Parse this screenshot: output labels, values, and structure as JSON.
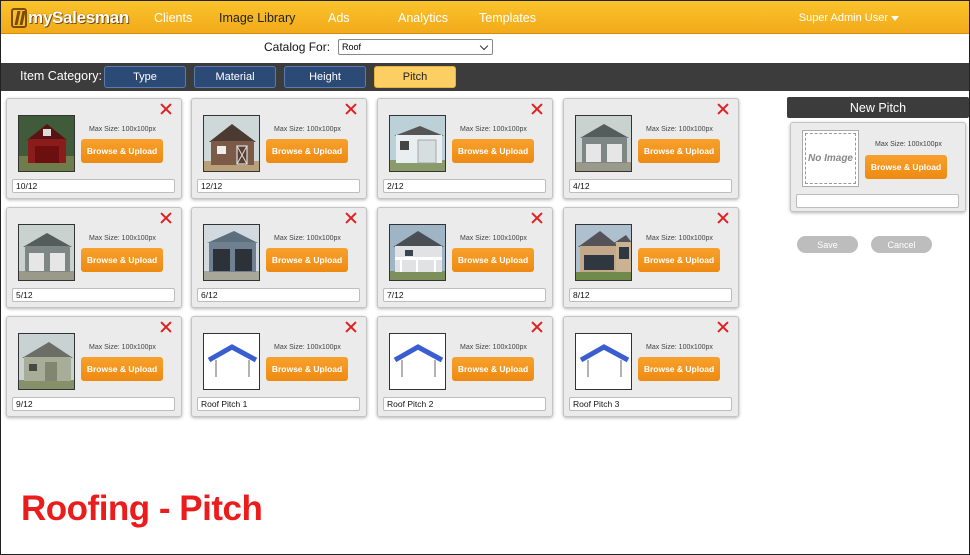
{
  "nav": {
    "logo": "mySalesman",
    "items": [
      "Clients",
      "Image Library",
      "Ads",
      "Analytics",
      "Templates"
    ],
    "active": "Image Library",
    "user": "Super Admin User"
  },
  "catalog": {
    "label": "Catalog For:",
    "value": "Roof"
  },
  "category_bar": {
    "label": "Item Category:",
    "buttons": [
      "Type",
      "Material",
      "Height",
      "Pitch"
    ],
    "active": "Pitch"
  },
  "item_defaults": {
    "max_size": "Max Size: 100x100px",
    "upload_label": "Browse & Upload"
  },
  "items": [
    {
      "name": "10/12",
      "thumb": "red-barn-icon"
    },
    {
      "name": "12/12",
      "thumb": "brown-barn-icon"
    },
    {
      "name": "2/12",
      "thumb": "white-shed-icon"
    },
    {
      "name": "4/12",
      "thumb": "grey-garage-icon"
    },
    {
      "name": "5/12",
      "thumb": "grey-garage-icon"
    },
    {
      "name": "6/12",
      "thumb": "blue-garage-icon"
    },
    {
      "name": "7/12",
      "thumb": "porch-house-icon"
    },
    {
      "name": "8/12",
      "thumb": "sunroom-house-icon"
    },
    {
      "name": "9/12",
      "thumb": "green-barn-icon"
    },
    {
      "name": "Roof Pitch 1",
      "thumb": "roof-pitch-diagram-icon"
    },
    {
      "name": "Roof Pitch 2",
      "thumb": "roof-pitch-diagram-icon"
    },
    {
      "name": "Roof Pitch 3",
      "thumb": "roof-pitch-diagram-icon"
    }
  ],
  "new_panel": {
    "title": "New Pitch",
    "no_image": "No Image",
    "max_size": "Max Size: 100x100px",
    "upload_label": "Browse & Upload",
    "name_value": "",
    "save_label": "Save",
    "cancel_label": "Cancel"
  },
  "caption": "Roofing - Pitch",
  "colors": {
    "accent": "#f3aa1b",
    "caption": "#ea1c1c",
    "upload": "#ee8a12",
    "active_category": "#fbcf63"
  }
}
